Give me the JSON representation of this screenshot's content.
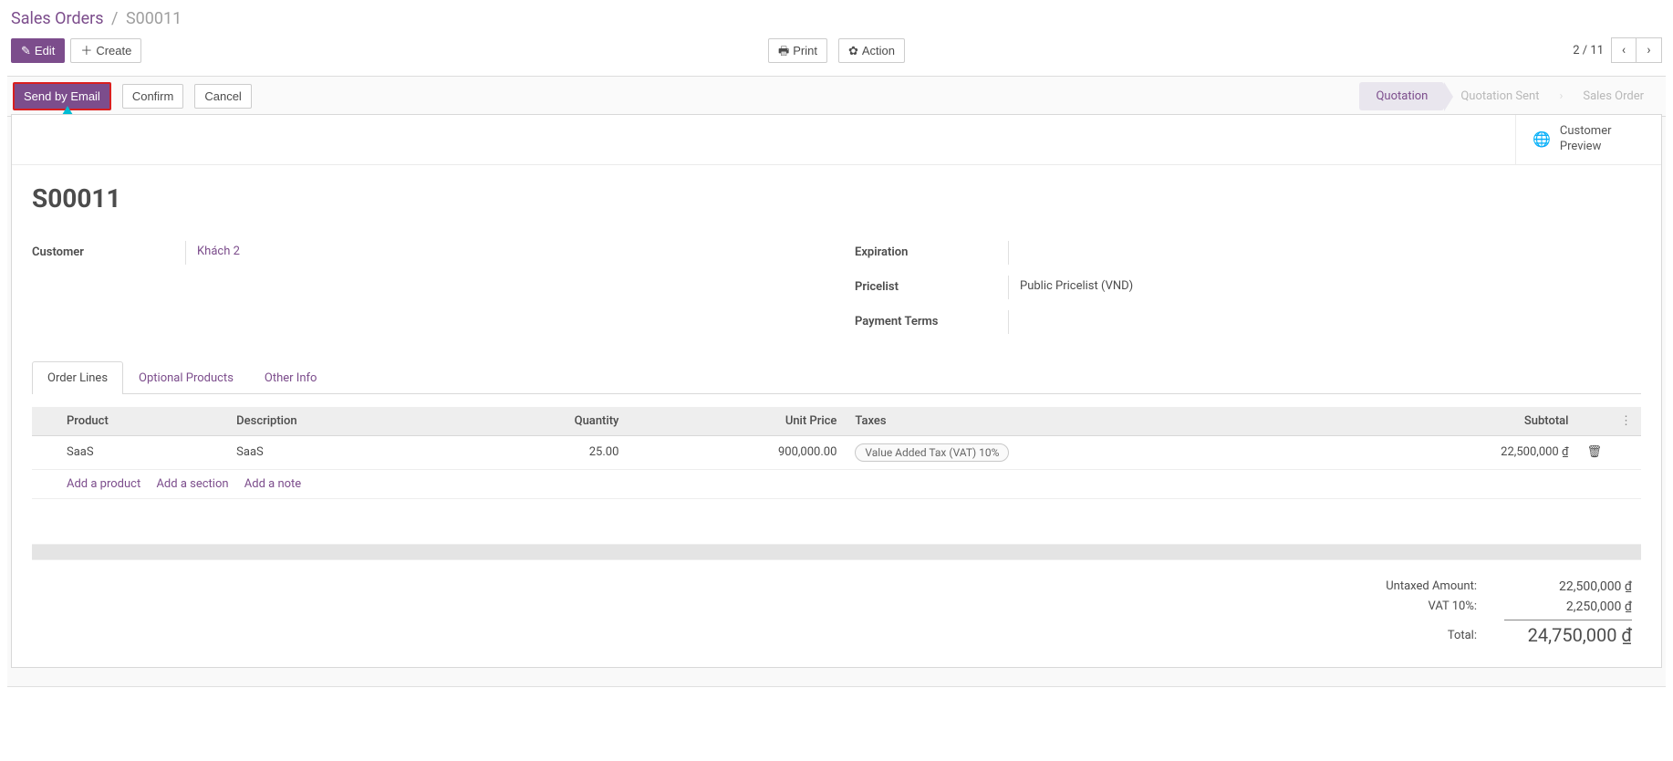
{
  "breadcrumb": {
    "root": "Sales Orders",
    "current": "S00011"
  },
  "toolbar": {
    "edit": "Edit",
    "create": "Create",
    "print": "Print",
    "action": "Action"
  },
  "pager": {
    "position": "2 / 11"
  },
  "statusbar": {
    "send_by_email": "Send by Email",
    "confirm": "Confirm",
    "cancel": "Cancel",
    "stages": {
      "quotation": "Quotation",
      "quotation_sent": "Quotation Sent",
      "sales_order": "Sales Order"
    }
  },
  "button_box": {
    "customer_preview_line1": "Customer",
    "customer_preview_line2": "Preview"
  },
  "form": {
    "title": "S00011",
    "labels": {
      "customer": "Customer",
      "expiration": "Expiration",
      "pricelist": "Pricelist",
      "payment_terms": "Payment Terms"
    },
    "values": {
      "customer": "Khách 2",
      "expiration": "",
      "pricelist": "Public Pricelist (VND)",
      "payment_terms": ""
    }
  },
  "tabs": {
    "order_lines": "Order Lines",
    "optional_products": "Optional Products",
    "other_info": "Other Info"
  },
  "table": {
    "headers": {
      "product": "Product",
      "description": "Description",
      "quantity": "Quantity",
      "unit_price": "Unit Price",
      "taxes": "Taxes",
      "subtotal": "Subtotal"
    },
    "rows": [
      {
        "product": "SaaS",
        "description": "SaaS",
        "quantity": "25.00",
        "unit_price": "900,000.00",
        "tax": "Value Added Tax (VAT) 10%",
        "subtotal": "22,500,000 ₫"
      }
    ],
    "add": {
      "product": "Add a product",
      "section": "Add a section",
      "note": "Add a note"
    }
  },
  "totals": {
    "untaxed_label": "Untaxed Amount:",
    "untaxed_value": "22,500,000 ₫",
    "vat_label": "VAT 10%:",
    "vat_value": "2,250,000 ₫",
    "total_label": "Total:",
    "total_value": "24,750,000 ₫"
  }
}
